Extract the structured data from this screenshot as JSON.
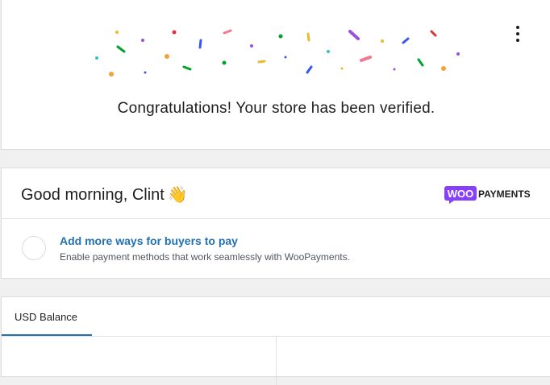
{
  "congrats": {
    "message": "Congratulations! Your store has been verified.",
    "menu_icon": "kebab-vertical-icon",
    "confetti_colors": [
      "#e8bb2f",
      "#9b51e0",
      "#d63638",
      "#3858e9",
      "#f2778f",
      "#00a32a",
      "#33c1c7",
      "#f2a33a"
    ]
  },
  "greeting": {
    "text": "Good morning, Clint",
    "emoji": "👋",
    "logo": {
      "woo": "WOO",
      "payments": "PAYMENTS",
      "woo_color": "#873eff"
    }
  },
  "task": {
    "title": "Add more ways for buyers to pay",
    "description": "Enable payment methods that work seamlessly with WooPayments.",
    "status_icon": "empty-circle-icon"
  },
  "balance": {
    "tabs": [
      {
        "label": "USD Balance",
        "active": true
      }
    ]
  }
}
